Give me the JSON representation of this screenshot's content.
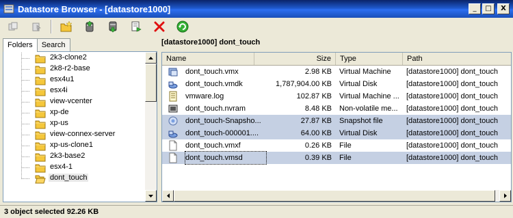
{
  "window": {
    "title": "Datastore Browser - [datastore1000]",
    "buttons": {
      "minimize": "_",
      "maximize": "□",
      "close": "X"
    }
  },
  "toolbar": {
    "icons": [
      "copy-icon",
      "paste-icon",
      "new-folder-icon",
      "upload-icon",
      "download-icon",
      "register-vm-icon",
      "delete-icon",
      "refresh-icon"
    ]
  },
  "left_panel": {
    "tabs": [
      {
        "label": "Folders",
        "active": true
      },
      {
        "label": "Search",
        "active": false
      }
    ],
    "tree_items": [
      {
        "label": "2k3-clone2"
      },
      {
        "label": "2k8-r2-base"
      },
      {
        "label": "esx4u1"
      },
      {
        "label": "esx4i"
      },
      {
        "label": "view-vcenter"
      },
      {
        "label": "xp-de"
      },
      {
        "label": "xp-us"
      },
      {
        "label": "view-connex-server"
      },
      {
        "label": "xp-us-clone1"
      },
      {
        "label": "2k3-base2"
      },
      {
        "label": "esx4-1"
      },
      {
        "label": "dont_touch",
        "selected": true
      }
    ]
  },
  "right_panel": {
    "header": "[datastore1000] dont_touch",
    "columns": [
      "Name",
      "Size",
      "Type",
      "Path"
    ],
    "rows": [
      {
        "icon": "vm-config-icon",
        "name": "dont_touch.vmx",
        "size": "2.98 KB",
        "type": "Virtual Machine",
        "path": "[datastore1000] dont_touch",
        "selected": false
      },
      {
        "icon": "virtual-disk-icon",
        "name": "dont_touch.vmdk",
        "size": "1,787,904.00 KB",
        "type": "Virtual Disk",
        "path": "[datastore1000] dont_touch",
        "selected": false
      },
      {
        "icon": "log-file-icon",
        "name": "vmware.log",
        "size": "102.87 KB",
        "type": "Virtual Machine ...",
        "path": "[datastore1000] dont_touch",
        "selected": false
      },
      {
        "icon": "nvram-icon",
        "name": "dont_touch.nvram",
        "size": "8.48 KB",
        "type": "Non-volatile me...",
        "path": "[datastore1000] dont_touch",
        "selected": false
      },
      {
        "icon": "snapshot-icon",
        "name": "dont_touch-Snapsho...",
        "size": "27.87 KB",
        "type": "Snapshot file",
        "path": "[datastore1000] dont_touch",
        "selected": true
      },
      {
        "icon": "virtual-disk-icon",
        "name": "dont_touch-000001....",
        "size": "64.00 KB",
        "type": "Virtual Disk",
        "path": "[datastore1000] dont_touch",
        "selected": true
      },
      {
        "icon": "file-icon",
        "name": "dont_touch.vmxf",
        "size": "0.26 KB",
        "type": "File",
        "path": "[datastore1000] dont_touch",
        "selected": false
      },
      {
        "icon": "file-icon",
        "name": "dont_touch.vmsd",
        "size": "0.39 KB",
        "type": "File",
        "path": "[datastore1000] dont_touch",
        "selected": true,
        "focused": true
      }
    ]
  },
  "status": {
    "text": "3 object selected 92.26 KB"
  },
  "colors": {
    "title_bar": "#1e57c9",
    "selection": "#c5d0e3",
    "window_bg": "#ece9d8"
  }
}
